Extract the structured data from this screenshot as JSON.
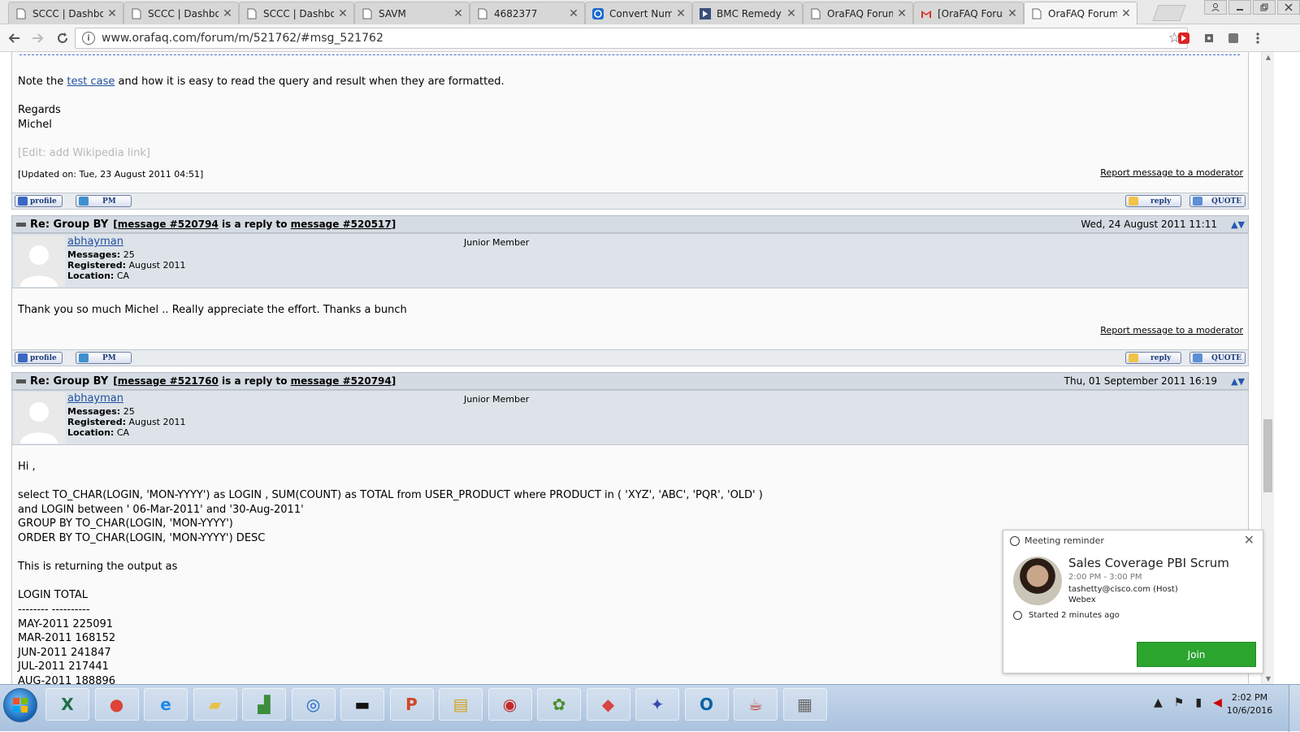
{
  "browser": {
    "tabs": [
      {
        "title": "SCCC | Dashbo",
        "favicon": "page-icon"
      },
      {
        "title": "SCCC | Dashbo",
        "favicon": "page-icon"
      },
      {
        "title": "SCCC | Dashbo",
        "favicon": "page-icon"
      },
      {
        "title": "SAVM",
        "favicon": "page-icon"
      },
      {
        "title": "4682377",
        "favicon": "page-icon"
      },
      {
        "title": "Convert Numb",
        "favicon": "converter-icon"
      },
      {
        "title": "BMC Remedy (",
        "favicon": "remedy-icon"
      },
      {
        "title": "OraFAQ Forum",
        "favicon": "page-icon"
      },
      {
        "title": "[OraFAQ Forun",
        "favicon": "gmail-icon"
      },
      {
        "title": "OraFAQ Forum",
        "favicon": "page-icon",
        "active": true
      }
    ],
    "close_glyph": "✕",
    "url": "www.orafaq.com/forum/m/521762/#msg_521762"
  },
  "post1": {
    "note_prefix": "Note the ",
    "note_link": "test case",
    "note_suffix": " and how it is easy to read the query and result when they are formatted.",
    "regards": "Regards",
    "signature": "Michel",
    "edit_note": "[Edit: add Wikipedia link]",
    "updated": "[Updated on: Tue, 23 August 2011 04:51]",
    "report": "Report message to a moderator"
  },
  "buttons": {
    "profile": "profile",
    "pm": "pm",
    "reply": "reply",
    "quote": "quote"
  },
  "post2": {
    "subject": "Re: Group BY",
    "reply_open": "[",
    "msg_link": "message #520794",
    "reply_mid": " is a reply to ",
    "parent_link": "message #520517",
    "reply_close": "]",
    "date": "Wed, 24 August 2011 11:11",
    "user": "abhayman",
    "rank": "Junior Member",
    "messages_label": "Messages:",
    "messages": "25",
    "registered_label": "Registered:",
    "registered": "August 2011",
    "location_label": "Location:",
    "location": "CA",
    "body": "Thank you so much Michel .. Really appreciate the effort. Thanks a bunch",
    "report": "Report message to a moderator"
  },
  "post3": {
    "subject": "Re: Group BY",
    "reply_open": "[",
    "msg_link": "message #521760",
    "reply_mid": " is a reply to ",
    "parent_link": "message #520794",
    "reply_close": "]",
    "date": "Thu, 01 September 2011 16:19",
    "user": "abhayman",
    "rank": "Junior Member",
    "messages_label": "Messages:",
    "messages": "25",
    "registered_label": "Registered:",
    "registered": "August 2011",
    "location_label": "Location:",
    "location": "CA",
    "body_lines": [
      "Hi ,",
      "",
      "select TO_CHAR(LOGIN, 'MON-YYYY') as LOGIN , SUM(COUNT) as TOTAL from USER_PRODUCT where PRODUCT in ( 'XYZ', 'ABC', 'PQR', 'OLD' )",
      "and LOGIN between ' 06-Mar-2011' and '30-Aug-2011'",
      "GROUP BY TO_CHAR(LOGIN, 'MON-YYYY')",
      "ORDER BY TO_CHAR(LOGIN, 'MON-YYYY') DESC",
      "",
      "This is returning the output as",
      "",
      "LOGIN TOTAL",
      "-------- ----------",
      "MAY-2011 225091",
      "MAR-2011 168152",
      "JUN-2011 241847",
      "JUL-2011 217441",
      "AUG-2011 188896"
    ]
  },
  "reminder": {
    "header": "Meeting reminder",
    "title": "Sales Coverage PBI Scrum",
    "time": "2:00 PM - 3:00 PM",
    "host": "tashetty@cisco.com (Host)",
    "location": "Webex",
    "started": "Started 2 minutes ago",
    "join": "Join"
  },
  "taskbar": {
    "apps": [
      "excel-icon",
      "chrome-icon",
      "ie-icon",
      "folder-icon",
      "chart-app-icon",
      "webex-icon",
      "cmd-icon",
      "powerpoint-icon",
      "explorer-icon",
      "media-icon",
      "toad-icon",
      "eraser-icon",
      "network-icon",
      "outlook-icon",
      "java-icon",
      "calculator-icon"
    ],
    "time": "2:02 PM",
    "date": "10/6/2016"
  },
  "colors": {
    "link": "#1f4f9e",
    "header_bg": "#d5dbe2",
    "join_green": "#2ca52f"
  }
}
